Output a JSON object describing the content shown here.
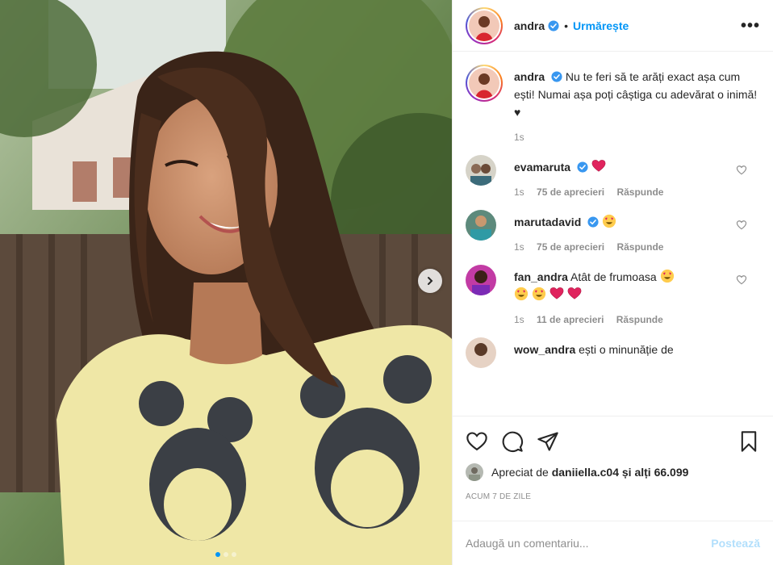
{
  "post": {
    "author": "andra",
    "follow_label": "Urmărește",
    "more_label": "•••",
    "caption": {
      "username": "andra",
      "text": "Nu te feri să te arăți exact așa cum ești! Numai așa poți câștiga cu adevărat o inimă! ♥",
      "age": "1s"
    },
    "comments": [
      {
        "username": "evamaruta",
        "text": "",
        "emoji": "red-heart",
        "age": "1s",
        "likes": "75 de aprecieri",
        "reply": "Răspunde"
      },
      {
        "username": "marutadavid",
        "text": "",
        "emoji": "heart-eyes",
        "age": "1s",
        "likes": "75 de aprecieri",
        "reply": "Răspunde"
      },
      {
        "username": "fan_andra",
        "text": "Atât de frumoasa",
        "emoji": "heart-eyes",
        "extra": "heart-eyes heart-eyes red-heart red-heart",
        "age": "1s",
        "likes": "11 de aprecieri",
        "reply": "Răspunde"
      },
      {
        "username": "wow_andra",
        "text": "ești o minunăție de"
      }
    ],
    "liked_by_prefix": "Apreciat de",
    "liked_by_user": "daniiella.c04",
    "liked_by_suffix": "și alți 66.099",
    "date": "ACUM 7 DE ZILE",
    "comment_placeholder": "Adaugă un comentariu...",
    "post_label": "Postează"
  },
  "colors": {
    "accent": "#0095f6",
    "verified": "#3897f0",
    "post_button_disabled": "#b2dffc",
    "meta_text": "#8e8e8e"
  },
  "icons": [
    "verified-icon",
    "more-icon",
    "like-icon",
    "comment-icon",
    "share-icon",
    "save-icon",
    "next-arrow-icon",
    "small-heart-icon"
  ]
}
